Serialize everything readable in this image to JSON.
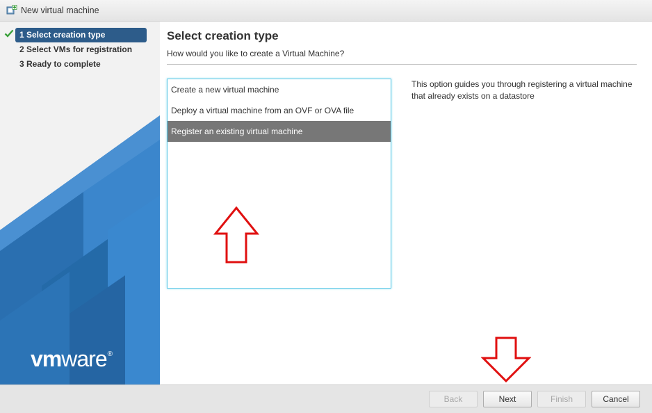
{
  "window": {
    "title": "New virtual machine",
    "icon": "new-vm-icon"
  },
  "sidebar": {
    "steps": [
      {
        "number": "1",
        "label": "1 Select creation type",
        "active": true,
        "completed_icon": "check-icon"
      },
      {
        "number": "2",
        "label": "2 Select VMs for registration",
        "active": false
      },
      {
        "number": "3",
        "label": "3 Ready to complete",
        "active": false
      }
    ],
    "logo": {
      "vm": "vm",
      "ware": "ware",
      "mark": "®"
    }
  },
  "main": {
    "title": "Select creation type",
    "subtitle": "How would you like to create a Virtual Machine?",
    "options": [
      {
        "label": "Create a new virtual machine",
        "selected": false
      },
      {
        "label": "Deploy a virtual machine from an OVF or OVA file",
        "selected": false
      },
      {
        "label": "Register an existing virtual machine",
        "selected": true
      }
    ],
    "description": "This option guides you through registering a virtual machine that already exists on a datastore"
  },
  "footer": {
    "back": "Back",
    "next": "Next",
    "finish": "Finish",
    "cancel": "Cancel"
  },
  "annotations": {
    "arrow_color": "#e01010",
    "arrow_up_icon": "red-up-arrow-icon",
    "arrow_down_icon": "red-down-arrow-icon"
  },
  "colors": {
    "active_step": "#2d5c8a",
    "selected_option": "#777777",
    "list_border": "#5ec8e6",
    "sidebar_blue": "#2f7ac0"
  }
}
